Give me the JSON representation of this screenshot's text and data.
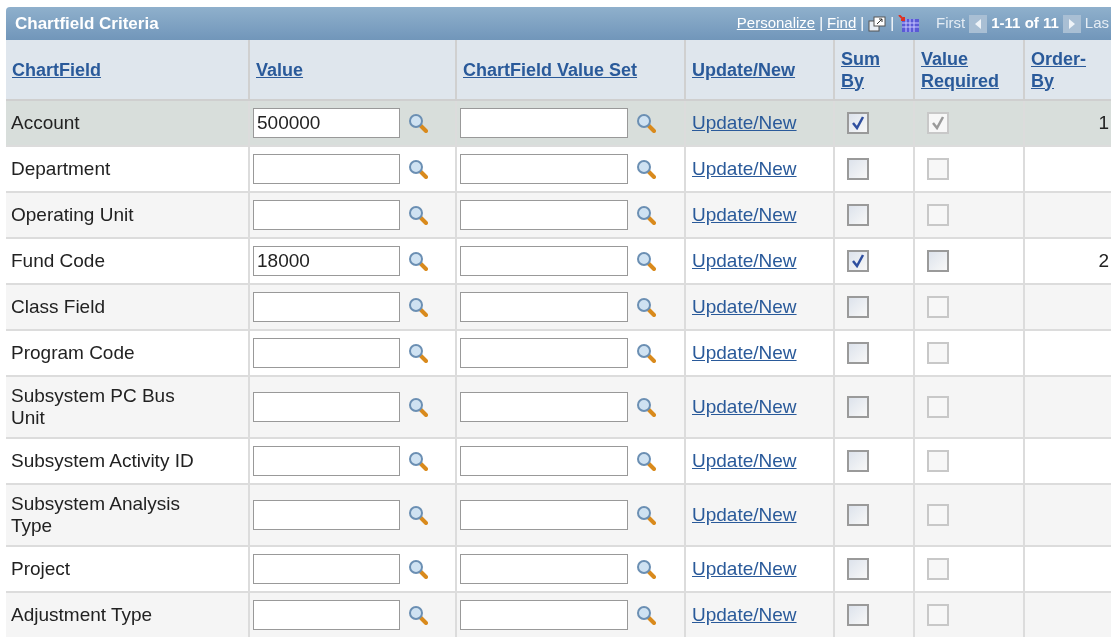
{
  "grid": {
    "title": "Chartfield Criteria",
    "toolbar": {
      "personalize": "Personalize",
      "find": "Find",
      "separators": [
        "|",
        "|",
        "|"
      ],
      "first": "First",
      "range": "1-11 of 11",
      "last": "Las"
    },
    "columns": [
      {
        "label": "ChartField"
      },
      {
        "label": "Value"
      },
      {
        "label": "ChartField Value Set"
      },
      {
        "label": "Update/New"
      },
      {
        "label": "Sum By"
      },
      {
        "label": "Value Required"
      },
      {
        "label": "Order-By"
      }
    ],
    "rows": [
      {
        "chartfield": "Account",
        "value": "500000",
        "value_set": "",
        "link": "Update/New",
        "selected": true,
        "sum_by": {
          "checked": true
        },
        "value_required": {
          "checked": true,
          "disabled": true
        },
        "order_by": "1"
      },
      {
        "chartfield": "Department",
        "value": "",
        "value_set": "",
        "link": "Update/New",
        "selected": false,
        "sum_by": {
          "checked": false
        },
        "value_required": {
          "checked": false,
          "disabled": true
        },
        "order_by": ""
      },
      {
        "chartfield": "Operating Unit",
        "value": "",
        "value_set": "",
        "link": "Update/New",
        "selected": false,
        "sum_by": {
          "checked": false
        },
        "value_required": {
          "checked": false,
          "disabled": true
        },
        "order_by": ""
      },
      {
        "chartfield": "Fund Code",
        "value": "18000",
        "value_set": "",
        "link": "Update/New",
        "selected": false,
        "sum_by": {
          "checked": true
        },
        "value_required": {
          "checked": false,
          "disabled": false
        },
        "order_by": "2"
      },
      {
        "chartfield": "Class Field",
        "value": "",
        "value_set": "",
        "link": "Update/New",
        "selected": false,
        "sum_by": {
          "checked": false
        },
        "value_required": {
          "checked": false,
          "disabled": true
        },
        "order_by": ""
      },
      {
        "chartfield": "Program Code",
        "value": "",
        "value_set": "",
        "link": "Update/New",
        "selected": false,
        "sum_by": {
          "checked": false
        },
        "value_required": {
          "checked": false,
          "disabled": true
        },
        "order_by": ""
      },
      {
        "chartfield": "Subsystem PC Bus Unit",
        "value": "",
        "value_set": "",
        "link": "Update/New",
        "selected": false,
        "sum_by": {
          "checked": false
        },
        "value_required": {
          "checked": false,
          "disabled": true
        },
        "order_by": ""
      },
      {
        "chartfield": "Subsystem Activity ID",
        "value": "",
        "value_set": "",
        "link": "Update/New",
        "selected": false,
        "sum_by": {
          "checked": false
        },
        "value_required": {
          "checked": false,
          "disabled": true
        },
        "order_by": ""
      },
      {
        "chartfield": "Subsystem Analysis Type",
        "value": "",
        "value_set": "",
        "link": "Update/New",
        "selected": false,
        "sum_by": {
          "checked": false
        },
        "value_required": {
          "checked": false,
          "disabled": true
        },
        "order_by": ""
      },
      {
        "chartfield": "Project",
        "value": "",
        "value_set": "",
        "link": "Update/New",
        "selected": false,
        "sum_by": {
          "checked": false
        },
        "value_required": {
          "checked": false,
          "disabled": true
        },
        "order_by": ""
      },
      {
        "chartfield": "Adjustment Type",
        "value": "",
        "value_set": "",
        "link": "Update/New",
        "selected": false,
        "sum_by": {
          "checked": false
        },
        "value_required": {
          "checked": false,
          "disabled": true
        },
        "order_by": ""
      }
    ]
  }
}
